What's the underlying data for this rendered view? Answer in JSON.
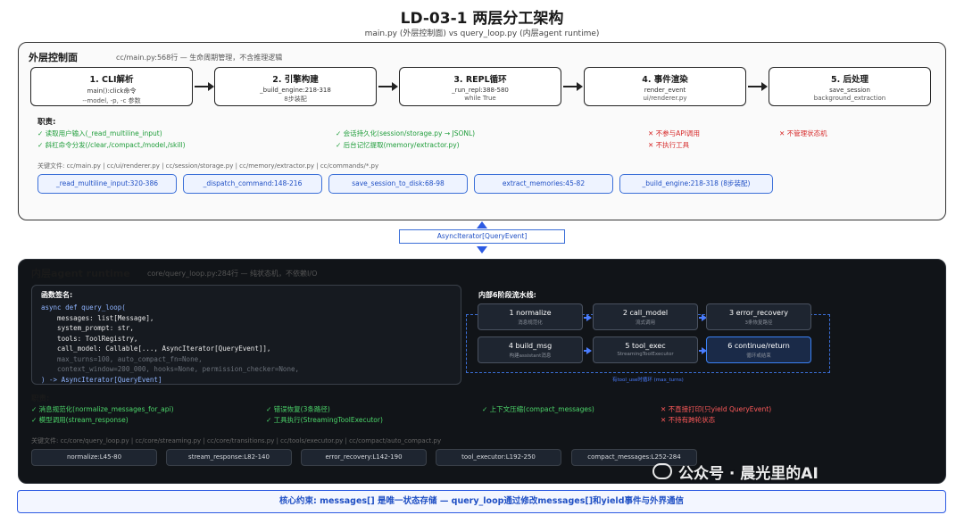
{
  "title": "LD-03-1 两层分工架构",
  "subtitle": "main.py (外层控制面) vs query_loop.py (内层agent runtime)",
  "outer": {
    "title": "外层控制面",
    "meta": "cc/main.py:568行 — 生命周期管理，不含推理逻辑",
    "stages": [
      {
        "title": "1. CLI解析",
        "line1": "main():click命令",
        "line2": "--model, -p, -c 参数"
      },
      {
        "title": "2. 引擎构建",
        "line1": "_build_engine:218-318",
        "line2": "8步装配"
      },
      {
        "title": "3. REPL循环",
        "line1": "_run_repl:388-580",
        "line2": "while True"
      },
      {
        "title": "4. 事件渲染",
        "line1": "render_event",
        "line2": "ui/renderer.py"
      },
      {
        "title": "5. 后处理",
        "line1": "save_session",
        "line2": "background_extraction"
      }
    ],
    "duty_title": "职责:",
    "duties_ok": [
      "✓ 读取用户输入(_read_multiline_input)",
      "✓ 斜杠命令分发(/clear,/compact,/model,/skill)",
      "✓ 会话持久化(session/storage.py → JSONL)",
      "✓ 后台记忆提取(memory/extractor.py)"
    ],
    "duties_no": [
      "✕ 不参与API调用",
      "✕ 不执行工具",
      "✕ 不管理状态机"
    ],
    "key_files": "关键文件: cc/main.py | cc/ui/renderer.py | cc/session/storage.py | cc/memory/extractor.py | cc/commands/*.py",
    "pills": [
      "_read_multiline_input:320-386",
      "_dispatch_command:148-216",
      "save_session_to_disk:68-98",
      "extract_memories:45-82",
      "_build_engine:218-318 (8步装配)"
    ]
  },
  "connector": "AsyncIterator[QueryEvent]",
  "inner": {
    "title": "内层agent runtime",
    "meta": "core/query_loop.py:284行 — 纯状态机，不依赖I/O",
    "code_title": "函数签名:",
    "code_lines": [
      "async def query_loop(",
      "    messages: list[Message],",
      "    system_prompt: str,",
      "    tools: ToolRegistry,",
      "    call_model: Callable[..., AsyncIterator[QueryEvent]],",
      "    max_turns=100, auto_compact_fn=None,",
      "    context_window=200_000, hooks=None, permission_checker=None,",
      ") -> AsyncIterator[QueryEvent]"
    ],
    "pipeline_title": "内部6阶段流水线:",
    "pipeline": [
      {
        "title": "1 normalize",
        "sub": "消息规范化"
      },
      {
        "title": "2 call_model",
        "sub": "流式调用"
      },
      {
        "title": "3 error_recovery",
        "sub": "3条恢复路径"
      },
      {
        "title": "4 build_msg",
        "sub": "构建assistant消息"
      },
      {
        "title": "5 tool_exec",
        "sub": "StreamingToolExecutor"
      },
      {
        "title": "6 continue/return",
        "sub": "循环或结束"
      }
    ],
    "loop_label": "有tool_use时循环 (max_turns)",
    "duty_title": "职责:",
    "duties_col1": [
      "✓ 消息规范化(normalize_messages_for_api)",
      "✓ 模型调用(stream_response)"
    ],
    "duties_col2": [
      "✓ 错误恢复(3条路径)",
      "✓ 工具执行(StreamingToolExecutor)"
    ],
    "duties_col3": [
      "✓ 上下文压缩(compact_messages)"
    ],
    "duties_no": [
      "✕ 不直接打印(只yield QueryEvent)",
      "✕ 不持有跨轮状态"
    ],
    "key_files": "关键文件: cc/core/query_loop.py | cc/core/streaming.py | cc/core/transitions.py | cc/tools/executor.py | cc/compact/auto_compact.py",
    "pills": [
      "normalize:L45-80",
      "stream_response:L82-140",
      "error_recovery:L142-190",
      "tool_executor:L192-250",
      "compact_messages:L252-284"
    ]
  },
  "core_constraint": "核心约束: messages[] 是唯一状态存储 — query_loop通过修改messages[]和yield事件与外界通信",
  "watermark": "公众号 · 晨光里的AI",
  "colors": {
    "accent": "#2d5be3",
    "ok": "#1f9d3a",
    "no": "#d62828",
    "dark_bg": "#111418"
  }
}
